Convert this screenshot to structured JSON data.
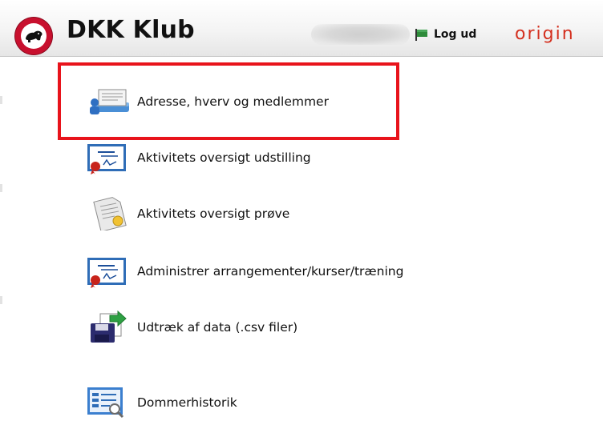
{
  "header": {
    "app_title": "DKK Klub",
    "logout_label": "Log ud",
    "brand": "origin",
    "logo_icon": "club-badge-icon",
    "logout_icon": "flag-icon",
    "redacted_username": true
  },
  "menu": {
    "items": [
      {
        "label": "Adresse, hverv og medlemmer",
        "icon": "address-book-icon",
        "highlighted": true
      },
      {
        "label": "Aktivitets oversigt udstilling",
        "icon": "certificate-chart-icon"
      },
      {
        "label": "Aktivitets oversigt prøve",
        "icon": "certificate-document-icon"
      },
      {
        "label": "Administrer arrangementer/kurser/træning",
        "icon": "certificate-chart-icon"
      },
      {
        "label": "Udtræk af data (.csv filer)",
        "icon": "export-disk-icon"
      },
      {
        "label": "Dommerhistorik",
        "icon": "judge-history-icon"
      }
    ]
  },
  "colors": {
    "highlight": "#e8131b",
    "brand": "#d4301f",
    "logo_red": "#c8102e"
  }
}
